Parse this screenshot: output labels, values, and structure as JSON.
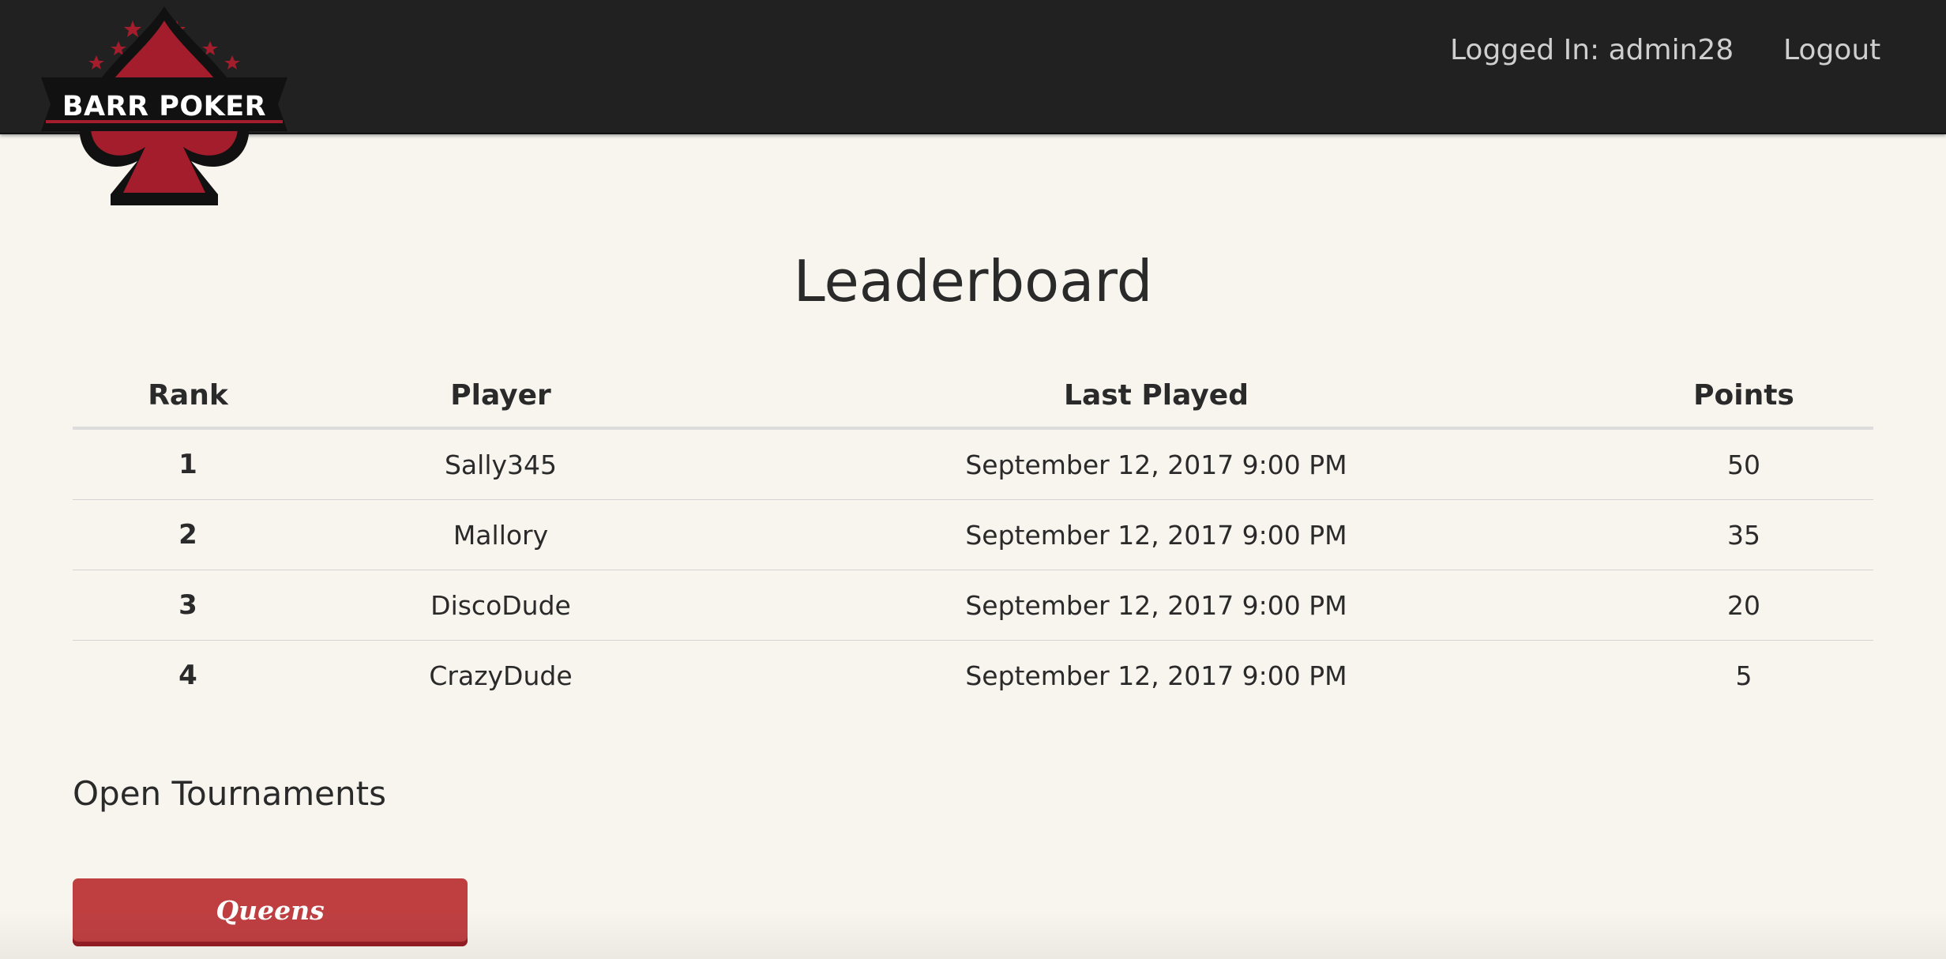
{
  "header": {
    "logo_text": "BARR POKER",
    "logged_in_text": "Logged In: admin28",
    "logout_label": "Logout"
  },
  "main": {
    "title": "Leaderboard",
    "table": {
      "columns": [
        "Rank",
        "Player",
        "Last Played",
        "Points"
      ],
      "rows": [
        {
          "rank": "1",
          "player": "Sally345",
          "last_played": "September 12, 2017 9:00 PM",
          "points": "50"
        },
        {
          "rank": "2",
          "player": "Mallory",
          "last_played": "September 12, 2017 9:00 PM",
          "points": "35"
        },
        {
          "rank": "3",
          "player": "DiscoDude",
          "last_played": "September 12, 2017 9:00 PM",
          "points": "20"
        },
        {
          "rank": "4",
          "player": "CrazyDude",
          "last_played": "September 12, 2017 9:00 PM",
          "points": "5"
        }
      ]
    },
    "open_tournaments": {
      "title": "Open Tournaments",
      "items": [
        {
          "label": "Queens"
        }
      ]
    }
  },
  "colors": {
    "header_bg": "#212121",
    "page_bg": "#f7f5ee",
    "accent_red": "#bf3f41",
    "logo_red": "#a31d2c"
  },
  "icons": {
    "logo": "spade-icon",
    "stars": "star-icon"
  }
}
